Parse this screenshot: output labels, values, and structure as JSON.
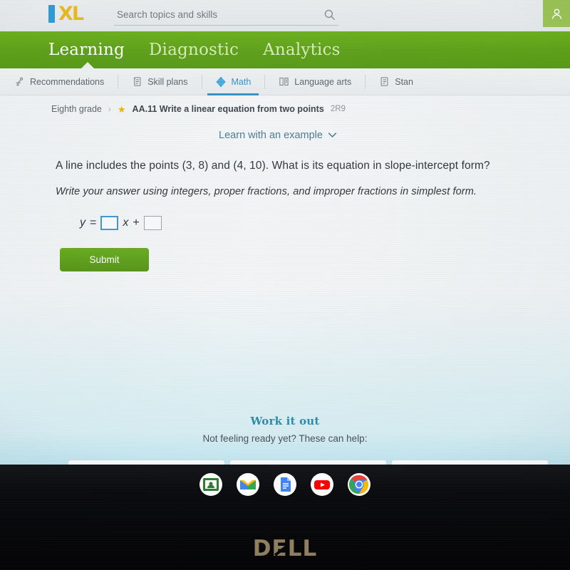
{
  "topbar": {
    "logo_i": "I",
    "logo_xl": "XL",
    "search_placeholder": "Search topics and skills",
    "search_value": "",
    "search_icon": "search-icon",
    "avatar_icon": "user-avatar-icon"
  },
  "greennav": {
    "items": [
      {
        "label": "Learning",
        "active": true
      },
      {
        "label": "Diagnostic",
        "active": false
      },
      {
        "label": "Analytics",
        "active": false
      }
    ]
  },
  "subnav": {
    "tabs": [
      {
        "label": "Recommendations",
        "icon": "recommendations-icon",
        "active": false
      },
      {
        "label": "Skill plans",
        "icon": "skill-plans-icon",
        "active": false
      },
      {
        "label": "Math",
        "icon": "math-prism-icon",
        "active": true
      },
      {
        "label": "Language arts",
        "icon": "book-icon",
        "active": false
      },
      {
        "label": "Stan",
        "icon": "clipboard-icon",
        "active": false
      }
    ]
  },
  "breadcrumb": {
    "grade": "Eighth grade",
    "separator": "›",
    "star": "★",
    "skill_title": "AA.11 Write a linear equation from two points",
    "skill_code": "2R9"
  },
  "example": {
    "label": "Learn with an example",
    "chevron": "⌄"
  },
  "question": {
    "prompt": "A line includes the points (3, 8) and (4, 10). What is its equation in slope-intercept form?",
    "instruction": "Write your answer using integers, proper fractions, and improper fractions in simplest form."
  },
  "answer": {
    "var_y": "y",
    "equals": "=",
    "slope_value": "",
    "var_x": "x",
    "plus": "+",
    "intercept_value": "",
    "submit_label": "Submit"
  },
  "workitout": {
    "title": "Work it out",
    "subtitle": "Not feeling ready yet? These can help:"
  },
  "dock": {
    "icons": [
      {
        "name": "google-classroom-icon"
      },
      {
        "name": "gmail-icon"
      },
      {
        "name": "google-docs-icon"
      },
      {
        "name": "youtube-icon"
      },
      {
        "name": "chrome-icon"
      }
    ]
  },
  "device": {
    "brand_d": "D",
    "brand_e": "E",
    "brand_ll": "LL"
  },
  "colors": {
    "brand_green": "#5da019",
    "accent_blue": "#2f93c9",
    "logo_blue": "#2f9bd4",
    "logo_gold": "#e8b922",
    "star_gold": "#e8b400",
    "teal_heading": "#2c8aa8",
    "focus_border": "#3e95d0",
    "dell_gold": "#a08f6a"
  }
}
